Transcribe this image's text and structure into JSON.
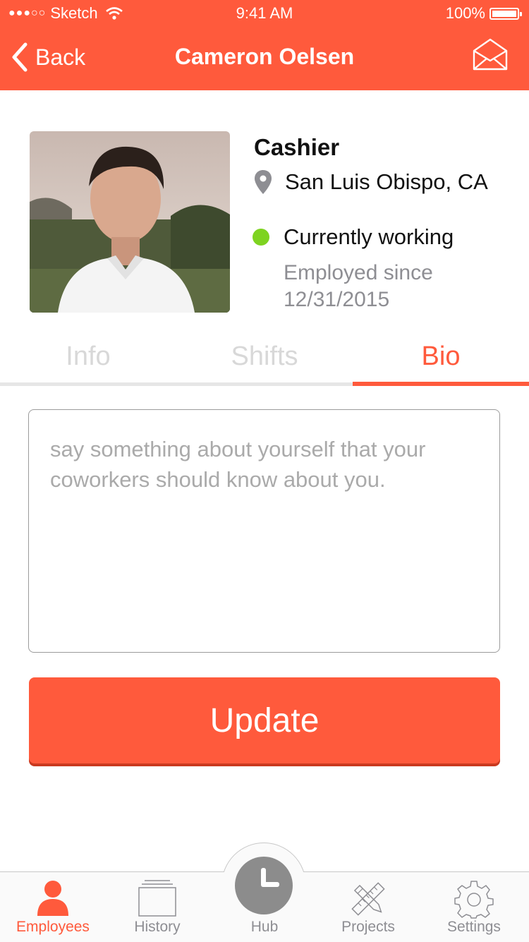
{
  "status_bar": {
    "carrier": "Sketch",
    "time": "9:41 AM",
    "battery": "100%"
  },
  "nav": {
    "back_label": "Back",
    "title": "Cameron Oelsen"
  },
  "profile": {
    "role": "Cashier",
    "location": "San Luis Obispo, CA",
    "status": "Currently working",
    "employed_since": "Employed since 12/31/2015"
  },
  "tabs": [
    {
      "label": "Info",
      "active": false
    },
    {
      "label": "Shifts",
      "active": false
    },
    {
      "label": "Bio",
      "active": true
    }
  ],
  "bio": {
    "value": "",
    "placeholder": "say something about yourself that your coworkers should know about you."
  },
  "update_label": "Update",
  "tabbar": [
    {
      "label": "Employees",
      "icon": "person-icon",
      "active": true
    },
    {
      "label": "History",
      "icon": "history-icon",
      "active": false
    },
    {
      "label": "Hub",
      "icon": "clock-icon",
      "active": false
    },
    {
      "label": "Projects",
      "icon": "pencil-ruler-icon",
      "active": false
    },
    {
      "label": "Settings",
      "icon": "gear-icon",
      "active": false
    }
  ],
  "colors": {
    "accent": "#FF5A3C",
    "status_green": "#7ED321",
    "muted": "#8E8E93"
  }
}
